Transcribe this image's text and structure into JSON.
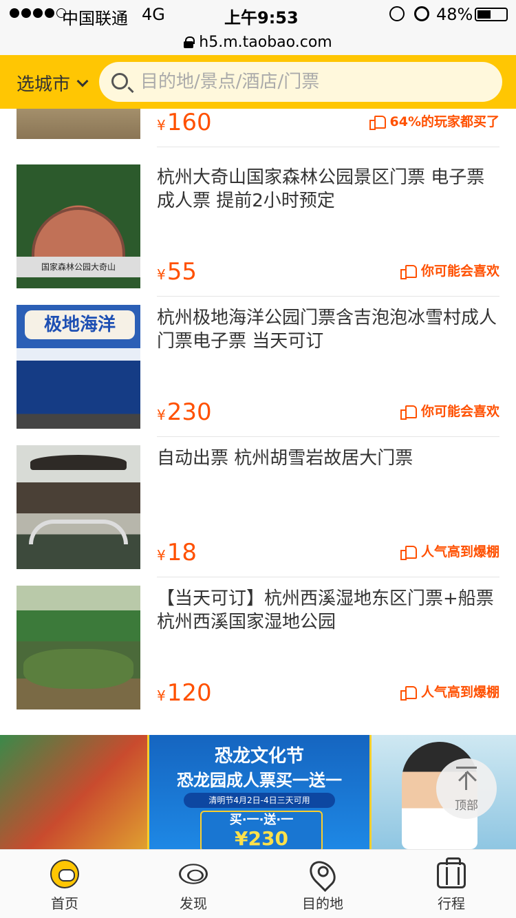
{
  "status_bar": {
    "carrier": "中国联通",
    "network": "4G",
    "time": "上午9:53",
    "battery_percent_text": "48%",
    "battery_level": 0.48
  },
  "url_bar": {
    "url": "h5.m.taobao.com"
  },
  "header": {
    "city_label": "选城市",
    "search_placeholder": "目的地/景点/酒店/门票"
  },
  "items": [
    {
      "title": "",
      "price": "160",
      "currency": "¥",
      "tag": "64%的玩家都买了"
    },
    {
      "title": "杭州大奇山国家森林公园景区门票 电子票 成人票 提前2小时预定",
      "thumb_text": "国家森林公园大奇山",
      "price": "55",
      "currency": "¥",
      "tag": "你可能会喜欢"
    },
    {
      "title": "杭州极地海洋公园门票含吉泡泡冰雪村成人门票电子票 当天可订",
      "thumb_text": "极地海洋",
      "price": "230",
      "currency": "¥",
      "tag": "你可能会喜欢"
    },
    {
      "title": "自动出票 杭州胡雪岩故居大门票",
      "price": "18",
      "currency": "¥",
      "tag": "人气高到爆棚"
    },
    {
      "title": "【当天可订】杭州西溪湿地东区门票+船票 杭州西溪国家湿地公园",
      "price": "120",
      "currency": "¥",
      "tag": "人气高到爆棚"
    }
  ],
  "banner": {
    "title": "恐龙文化节",
    "subtitle": "恐龙园成人票买一送一",
    "date_note": "清明节4月2日-4日三天可用",
    "promo": "买·一·送·一",
    "price": "¥230"
  },
  "back_to_top": {
    "label": "顶部"
  },
  "tabbar": {
    "tabs": [
      {
        "label": "首页",
        "icon": "home-icon"
      },
      {
        "label": "发现",
        "icon": "eye-icon"
      },
      {
        "label": "目的地",
        "icon": "location-pin-icon"
      },
      {
        "label": "行程",
        "icon": "suitcase-icon"
      }
    ]
  },
  "colors": {
    "accent_yellow": "#ffc603",
    "price_orange": "#ff5000"
  }
}
